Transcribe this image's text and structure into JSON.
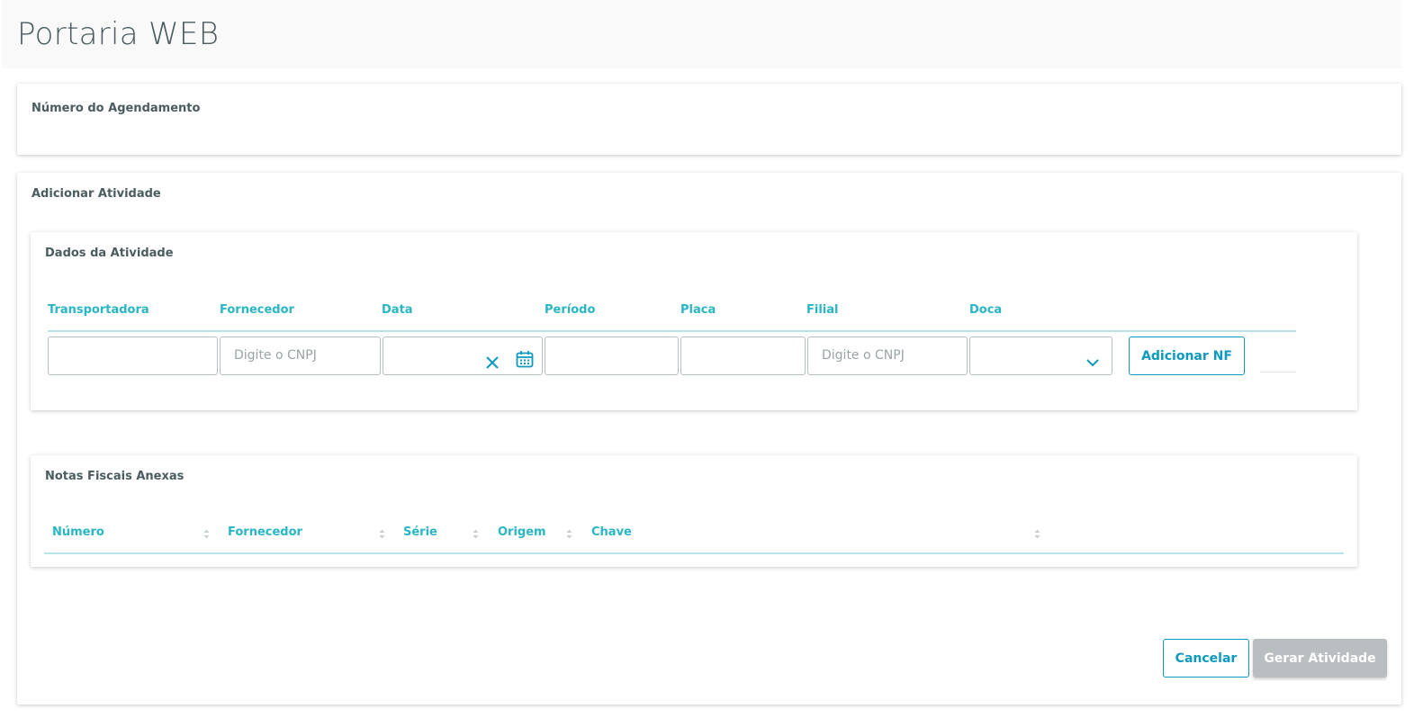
{
  "page": {
    "title": "Portaria WEB"
  },
  "agendamento": {
    "title": "Número do Agendamento"
  },
  "adicionar": {
    "title": "Adicionar Atividade"
  },
  "dados": {
    "title": "Dados da Atividade",
    "labels": {
      "transportadora": "Transportadora",
      "fornecedor": "Fornecedor",
      "data": "Data",
      "periodo": "Período",
      "placa": "Placa",
      "filial": "Filial",
      "doca": "Doca"
    },
    "placeholders": {
      "fornecedor": "Digite o CNPJ",
      "filial": "Digite o CNPJ"
    },
    "add_nf_label": "Adicionar NF"
  },
  "notas": {
    "title": "Notas Fiscais Anexas",
    "columns": [
      "Número",
      "Fornecedor",
      "Série",
      "Origem",
      "Chave"
    ]
  },
  "actions": {
    "cancel_label": "Cancelar",
    "generate_label": "Gerar Atividade"
  },
  "colors": {
    "accent": "#0c9abe",
    "label": "#29b6c5",
    "disabled": "#b9bfc1"
  },
  "icons": {
    "clear": "close-icon",
    "calendar": "calendar-icon",
    "dropdown": "chevron-down-icon",
    "sort": "sort-icon"
  }
}
